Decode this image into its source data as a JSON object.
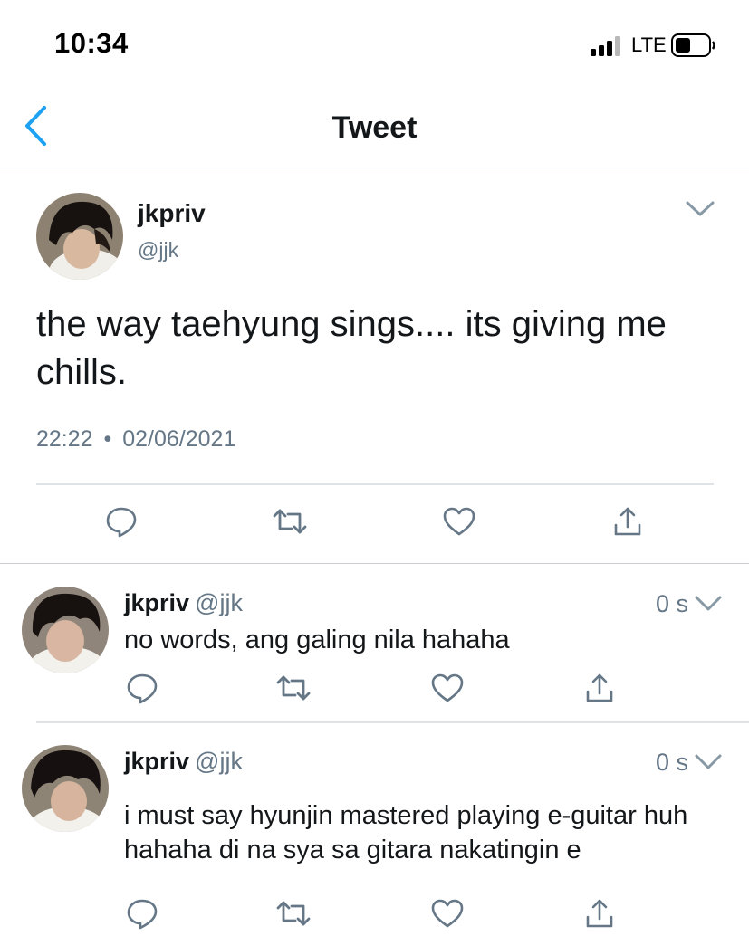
{
  "status_bar": {
    "time": "10:34",
    "network": "LTE"
  },
  "nav": {
    "title": "Tweet"
  },
  "main_tweet": {
    "name": "jkpriv",
    "handle": "@jjk",
    "text": "the way taehyung sings.... its giving me chills.",
    "time": "22:22",
    "separator": "•",
    "date": "02/06/2021"
  },
  "replies": [
    {
      "name": "jkpriv",
      "handle": "@jjk",
      "time": "0 s",
      "text": "no words, ang galing nila hahaha"
    },
    {
      "name": "jkpriv",
      "handle": "@jjk",
      "time": "0 s",
      "text": "i must say hyunjin mastered playing e-guitar huh hahaha di na sya sa gitara nakatingin e"
    }
  ],
  "colors": {
    "accent": "#1da1f2",
    "icon": "#657786",
    "divider": "#dfe3e6"
  },
  "icons": [
    "back-chevron-icon",
    "caret-down-icon",
    "reply-icon",
    "retweet-icon",
    "like-icon",
    "share-icon"
  ]
}
